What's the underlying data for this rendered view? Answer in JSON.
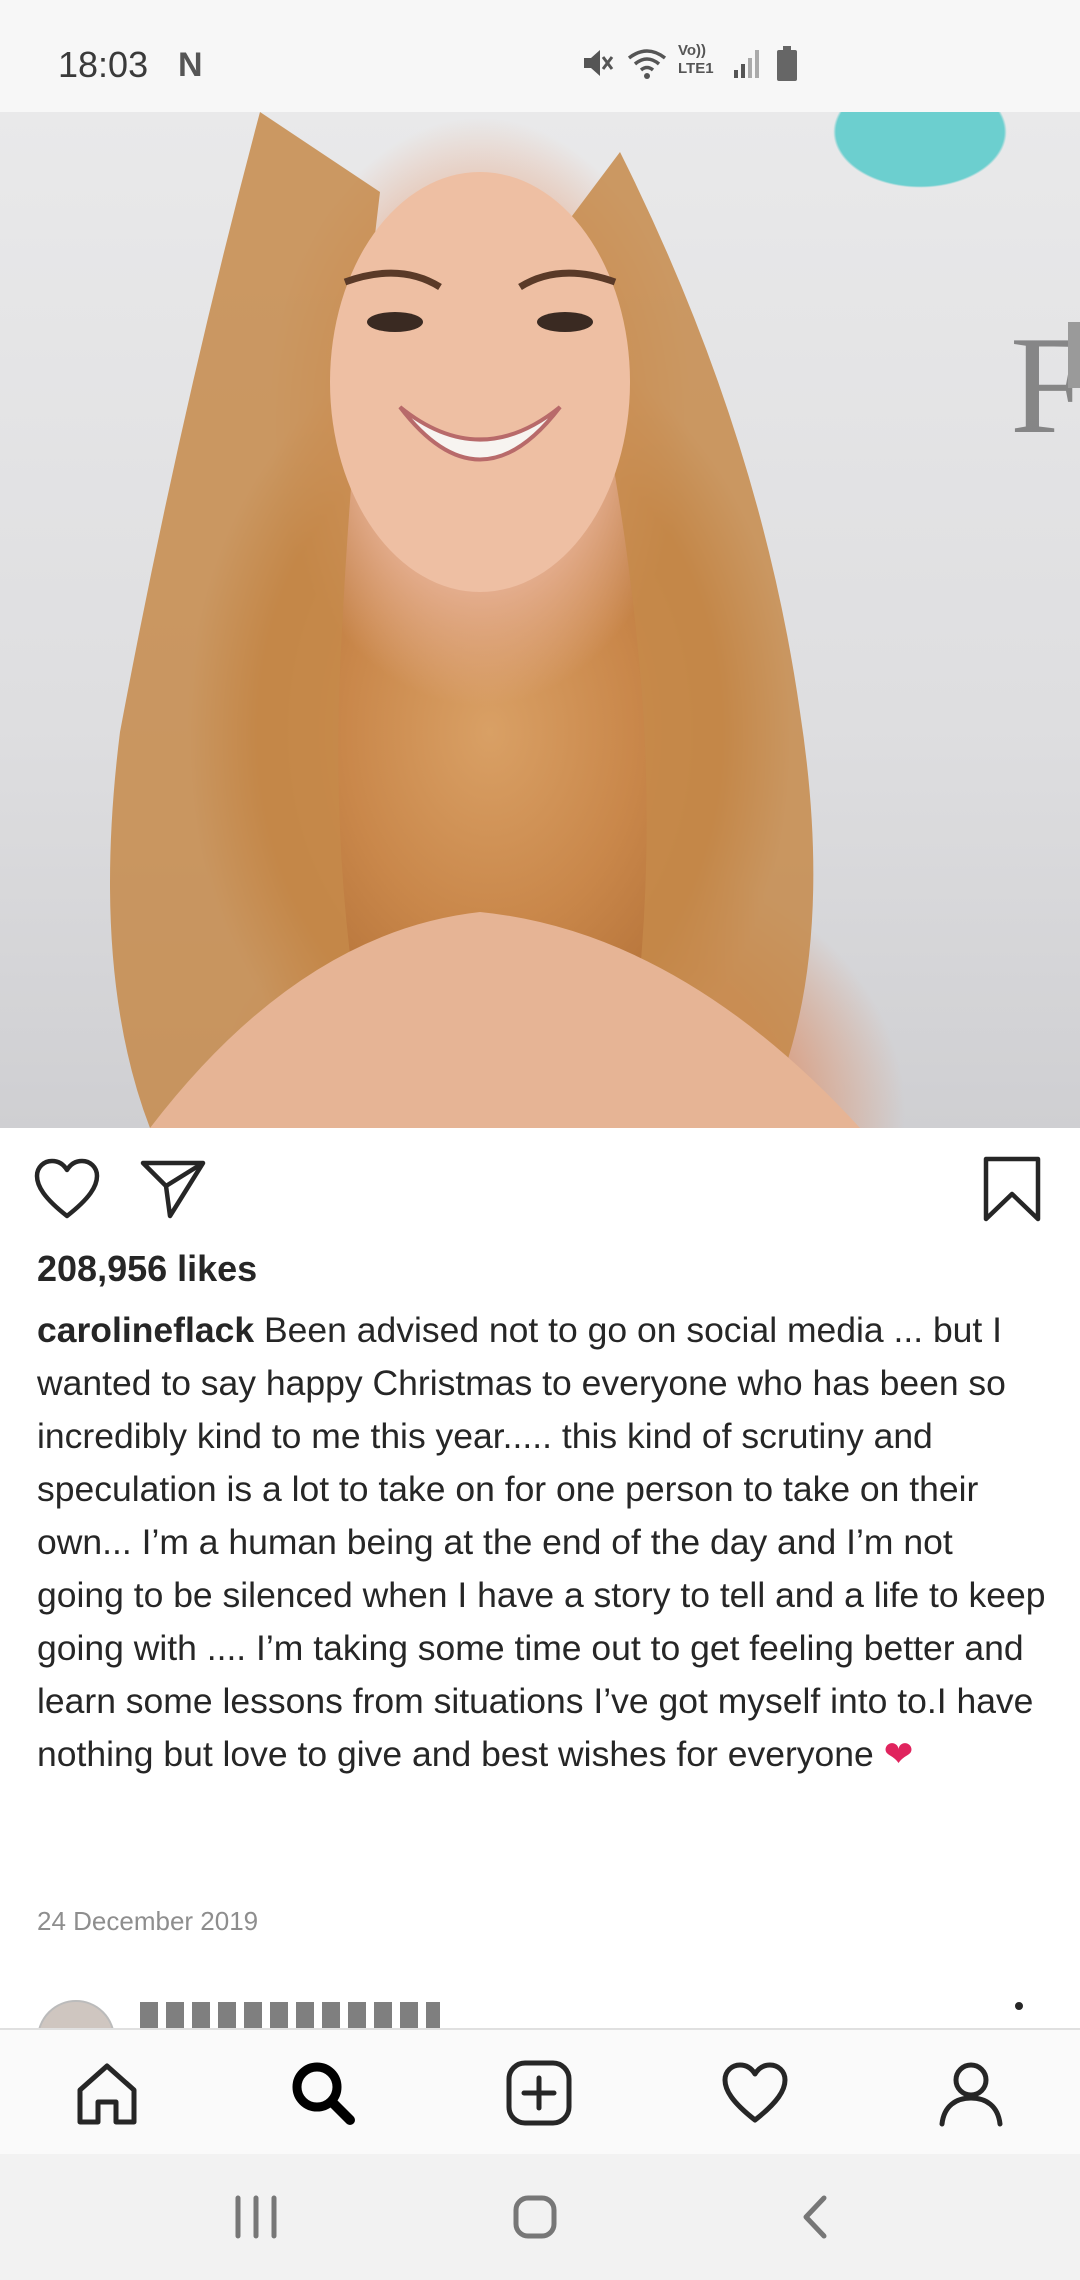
{
  "status_bar": {
    "time": "18:03",
    "notification_letter": "N",
    "icons": [
      "mute-icon",
      "wifi-icon",
      "volte-icon",
      "signal-icon",
      "battery-icon"
    ],
    "volte_label_top": "Vo))",
    "volte_label_bottom": "LTE1"
  },
  "post": {
    "image_alt": "carolineflack photo",
    "likes": "208,956 likes",
    "username": "carolineflack",
    "caption": "Been advised not to go on social media ... but I wanted to say happy Christmas to everyone who has been so incredibly kind to me this year..... this kind of scrutiny and speculation is a lot to take on for one person to take on their own... I’m a human being at the end of the day and I’m not going to be silenced when I have a story to tell and a life to keep going with .... I’m taking some time out to get feeling better and learn some lessons from situations I’ve got myself into to.I have nothing but love to give and best wishes for everyone",
    "caption_emoji": "❤",
    "date": "24 December 2019",
    "actions": [
      "heart-icon",
      "share-icon",
      "bookmark-icon"
    ]
  },
  "bottom_nav": {
    "items": [
      "home-icon",
      "search-icon",
      "add-icon",
      "activity-icon",
      "profile-icon"
    ],
    "active": "search-icon"
  },
  "system_nav": {
    "items": [
      "recents-button",
      "home-button",
      "back-button"
    ]
  },
  "colors": {
    "text": "#262626",
    "secondary_text": "#8e8e8e",
    "heart_emoji": "#e0245e",
    "status_bar_bg": "#f7f7f7",
    "nav_bg": "#fafafa"
  }
}
